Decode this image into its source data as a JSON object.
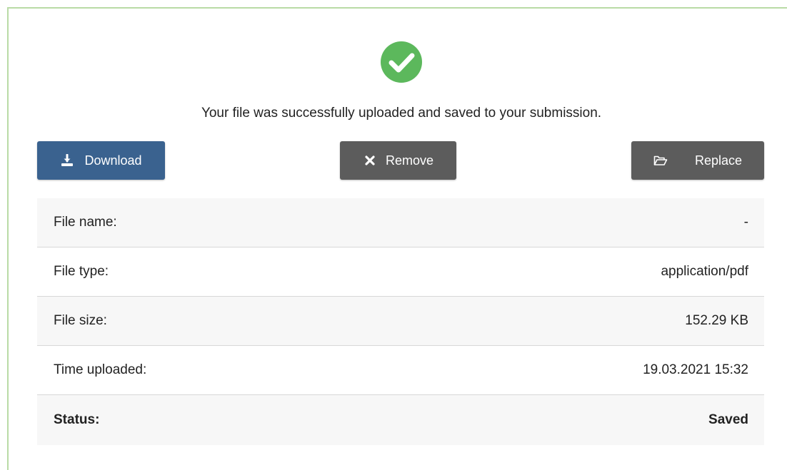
{
  "status": {
    "icon": "check-circle-icon",
    "message": "Your file was successfully uploaded and saved to your submission."
  },
  "actions": {
    "download_label": "Download",
    "download_icon": "download-icon",
    "remove_label": "Remove",
    "remove_icon": "close-icon",
    "replace_label": "Replace",
    "replace_icon": "folder-open-icon"
  },
  "file_info": {
    "rows": [
      {
        "label": "File name:",
        "value": "-"
      },
      {
        "label": "File type:",
        "value": "application/pdf"
      },
      {
        "label": "File size:",
        "value": "152.29 KB"
      },
      {
        "label": "Time uploaded:",
        "value": "19.03.2021 15:32"
      },
      {
        "label": "Status:",
        "value": "Saved"
      }
    ]
  },
  "colors": {
    "success": "#5cb85c",
    "primary": "#3a628f",
    "secondary": "#5c5c5c",
    "panel_border": "#b9dba6",
    "row_shade": "#f7f7f7"
  }
}
